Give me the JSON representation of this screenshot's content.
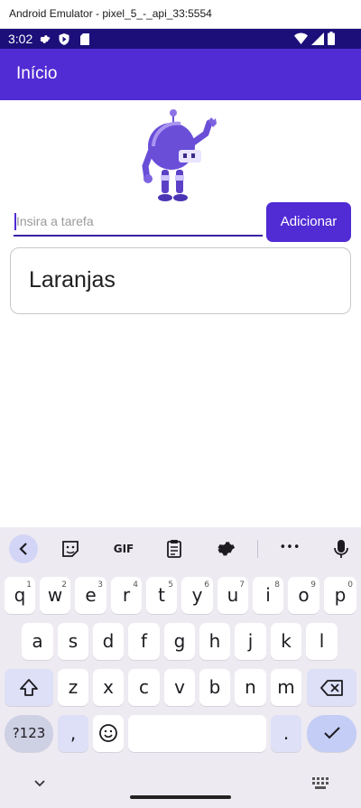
{
  "window": {
    "title": "Android Emulator - pixel_5_-_api_33:5554"
  },
  "status_bar": {
    "time": "3:02"
  },
  "app_bar": {
    "title": "Início"
  },
  "task_entry": {
    "placeholder": "Insira a tarefa"
  },
  "add_button": {
    "label": "Adicionar"
  },
  "tasks": [
    {
      "label": "Laranjas"
    }
  ],
  "keyboard": {
    "toolbar": {
      "gif": "GIF",
      "more": "•••"
    },
    "row1": [
      {
        "key": "q",
        "sup": "1"
      },
      {
        "key": "w",
        "sup": "2"
      },
      {
        "key": "e",
        "sup": "3"
      },
      {
        "key": "r",
        "sup": "4"
      },
      {
        "key": "t",
        "sup": "5"
      },
      {
        "key": "y",
        "sup": "6"
      },
      {
        "key": "u",
        "sup": "7"
      },
      {
        "key": "i",
        "sup": "8"
      },
      {
        "key": "o",
        "sup": "9"
      },
      {
        "key": "p",
        "sup": "0"
      }
    ],
    "row2": [
      "a",
      "s",
      "d",
      "f",
      "g",
      "h",
      "j",
      "k",
      "l"
    ],
    "row3": [
      "z",
      "x",
      "c",
      "v",
      "b",
      "n",
      "m"
    ],
    "symbols_key": "?123",
    "comma_key": ",",
    "period_key": "."
  },
  "colors": {
    "primary": "#512bd4",
    "status_bar": "#1c0f7a",
    "keyboard_bg": "#eeeaf2"
  }
}
